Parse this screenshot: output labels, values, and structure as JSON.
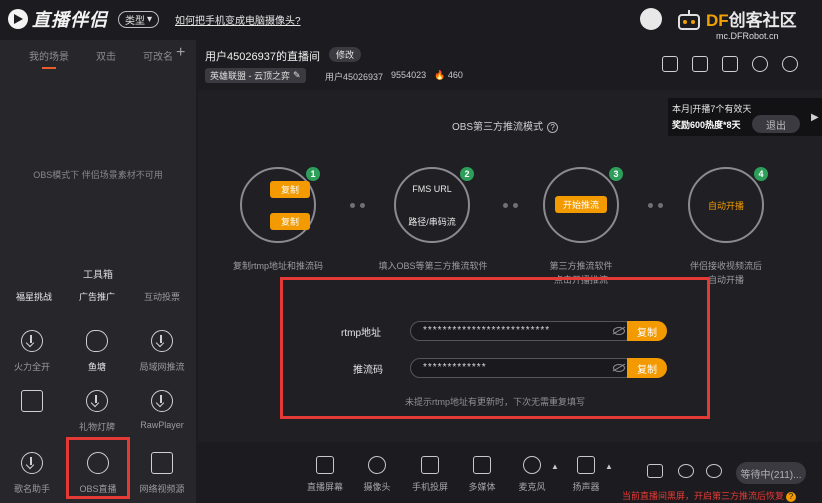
{
  "app": {
    "logo_text": "直播伴侣",
    "type_button": "类型",
    "howto_link": "如何把手机变成电脑摄像头?"
  },
  "watermark": {
    "title_brand": "DF",
    "title_rest": "创客社区",
    "subtitle": "mc.DFRobot.cn"
  },
  "scenes": {
    "tabs": [
      "我的场景",
      "双击",
      "可改名"
    ],
    "add": "+",
    "obs_note": "OBS模式下 伴侣场景素材不可用"
  },
  "toolbox": {
    "title": "工具箱",
    "items": [
      {
        "label": "福星挑战",
        "icon": "star-challenge-icon"
      },
      {
        "label": "广告推广",
        "icon": "ad-icon"
      },
      {
        "label": "互动投票",
        "icon": "vote-icon"
      },
      {
        "label": "火力全开",
        "icon": "download-icon"
      },
      {
        "label": "鱼塘",
        "icon": "fish-icon"
      },
      {
        "label": "局域网推流",
        "icon": "download-icon"
      },
      {
        "label": "",
        "icon": "gift-icon"
      },
      {
        "label": "礼物灯牌",
        "icon": "download-icon"
      },
      {
        "label": "RawPlayer",
        "icon": "download-icon"
      },
      {
        "label": "歌名助手",
        "icon": "download-icon"
      },
      {
        "label": "OBS直播",
        "icon": "obs-icon"
      },
      {
        "label": "网络视频源",
        "icon": "tv-icon"
      }
    ]
  },
  "room": {
    "title": "用户45026937的直播间",
    "modify": "修改",
    "category": "英雄联盟 - 云顶之弈",
    "user_id": "用户45026937",
    "room_number": "9554023",
    "heat": "460"
  },
  "promo": {
    "line1": "本月|开播7个有效天",
    "line2": "奖励600热度*8天",
    "exit": "退出"
  },
  "obs": {
    "title": "OBS第三方推流模式",
    "help": "?",
    "steps": [
      {
        "num": "1",
        "btn1": "复制",
        "btn2": "复制",
        "caption": "复制rtmp地址和推流码"
      },
      {
        "num": "2",
        "line1": "FMS URL",
        "line2": "路径/串码流",
        "caption": "填入OBS等第三方推流软件"
      },
      {
        "num": "3",
        "btn": "开始推流",
        "caption": "第三方推流软件\n点击开播推流"
      },
      {
        "num": "4",
        "btn": "自动开播",
        "caption": "伴侣接收视频流后\n自动开播"
      }
    ],
    "rtmp_label": "rtmp地址",
    "rtmp_value": "**************************",
    "key_label": "推流码",
    "key_value": "*************",
    "copy_label": "复制",
    "hint": "未提示rtmp地址有更新时，下次无需重复填写"
  },
  "bottombar": {
    "items": [
      {
        "label": "直播屏幕",
        "icon": "screen-icon"
      },
      {
        "label": "摄像头",
        "icon": "camera-icon"
      },
      {
        "label": "手机投屏",
        "icon": "phone-cast-icon"
      },
      {
        "label": "多媒体",
        "icon": "media-icon"
      },
      {
        "label": "麦克风",
        "icon": "mic-icon"
      },
      {
        "label": "扬声器",
        "icon": "speaker-icon"
      }
    ],
    "wait_button": "等待中(211)...",
    "warning": "当前直播间黑屏，开启第三方推流后恢复"
  }
}
